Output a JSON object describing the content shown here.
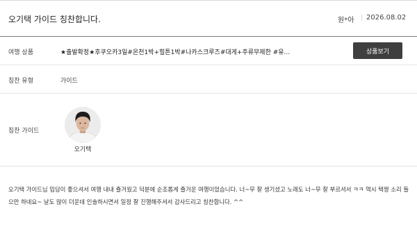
{
  "header": {
    "title": "오기택 가이드 칭찬합니다.",
    "author": "원*아",
    "date": "2026.08.02"
  },
  "product": {
    "label": "여행 상품",
    "value": "★출발확정★후쿠오카3일#온천1박+힐튼1박#나카스크루즈#대게+주류무제한 #유...",
    "button_label": "상품보기"
  },
  "praise_type": {
    "label": "칭찬 유형",
    "value": "가이드"
  },
  "praise_guide": {
    "label": "칭찬 가이드",
    "name": "오기택"
  },
  "review": {
    "text": "오기택 가이드님 입담이 좋으셔서 여행 내내 즐거웠고 덕분에 순조롭게 즐거운 여행이었습니다. 너~무 잘 생기셨고 노래도 너~무 잘 부르셔서 ㅋㅋ 역시 택짱 소리 들으만 하네요~ 날도 많이 더운데 인솔하시면서 일정 잘 진행해주셔서 감사드리고 칭찬합니다. ^^"
  },
  "colors": {
    "button_bg": "#3f3f3f",
    "header_rule": "#777777",
    "row_rule": "#e6e6e6"
  }
}
